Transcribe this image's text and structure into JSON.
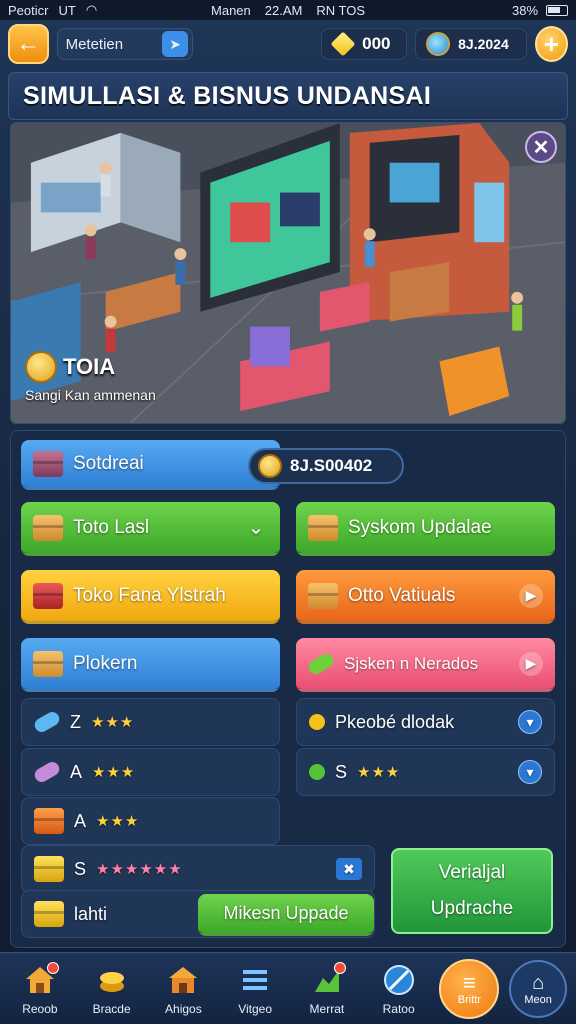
{
  "status_bar": {
    "carrier": "Peoticr",
    "network": "UT",
    "center_left": "Manen",
    "time": "22.AM",
    "center_right": "RN TOS",
    "battery": "38%"
  },
  "top_bar": {
    "player_name": "Metetien",
    "gems": "000",
    "coins": "8J.2024"
  },
  "title": "SIMULLASI & BISNUS UNDANSAI",
  "scene": {
    "shop_name": "TOIA",
    "shop_subtitle": "Sangi Kan ammenan"
  },
  "panel": {
    "header_button": "Sotdreai",
    "balance": "8J.S00402",
    "buttons": [
      {
        "label": "Toto Lasl",
        "color": "green",
        "icon": "box-icon"
      },
      {
        "label": "Syskom Updalae",
        "color": "green",
        "icon": "box-icon"
      },
      {
        "label": "Toko Fana Ylstrah",
        "color": "yellow",
        "icon": "box-icon"
      },
      {
        "label": "Otto Vatiuals",
        "color": "orange",
        "icon": "box-icon"
      },
      {
        "label": "Plokern",
        "color": "blue",
        "icon": "box-icon"
      },
      {
        "label": "Sjsken n Nerados",
        "color": "pink",
        "icon": "leaf-icon"
      }
    ],
    "left_list": [
      {
        "prefix": "Z",
        "stars": "★★★"
      },
      {
        "prefix": "A",
        "stars": "★★★"
      },
      {
        "prefix": "A",
        "stars": "★★★"
      },
      {
        "prefix": "S",
        "stars": "★★★★★★"
      },
      {
        "prefix": "lahti",
        "stars": ""
      }
    ],
    "right_list": [
      {
        "label": "Pkeobé dlodak"
      },
      {
        "prefix": "S",
        "stars": "★★★"
      }
    ],
    "upgrade_button": "Mikesn Uppade",
    "big_button": {
      "line1": "Verialjal",
      "line2": "Updrache"
    }
  },
  "bottom_nav": [
    {
      "label": "Reoob",
      "icon": "house-icon"
    },
    {
      "label": "Bracde",
      "icon": "coins-icon"
    },
    {
      "label": "Ahigos",
      "icon": "shop-icon"
    },
    {
      "label": "Vitgeo",
      "icon": "list-icon"
    },
    {
      "label": "Merrat",
      "icon": "chart-icon"
    },
    {
      "label": "Ratoo",
      "icon": "globe-icon"
    },
    {
      "label": "Brittr",
      "icon": "menu-icon"
    },
    {
      "label": "Meon",
      "icon": "home-icon"
    }
  ],
  "colors": {
    "accent_orange": "#f39a12",
    "green": "#3ea82a",
    "blue": "#2f7fd6",
    "panel": "#182a45"
  }
}
